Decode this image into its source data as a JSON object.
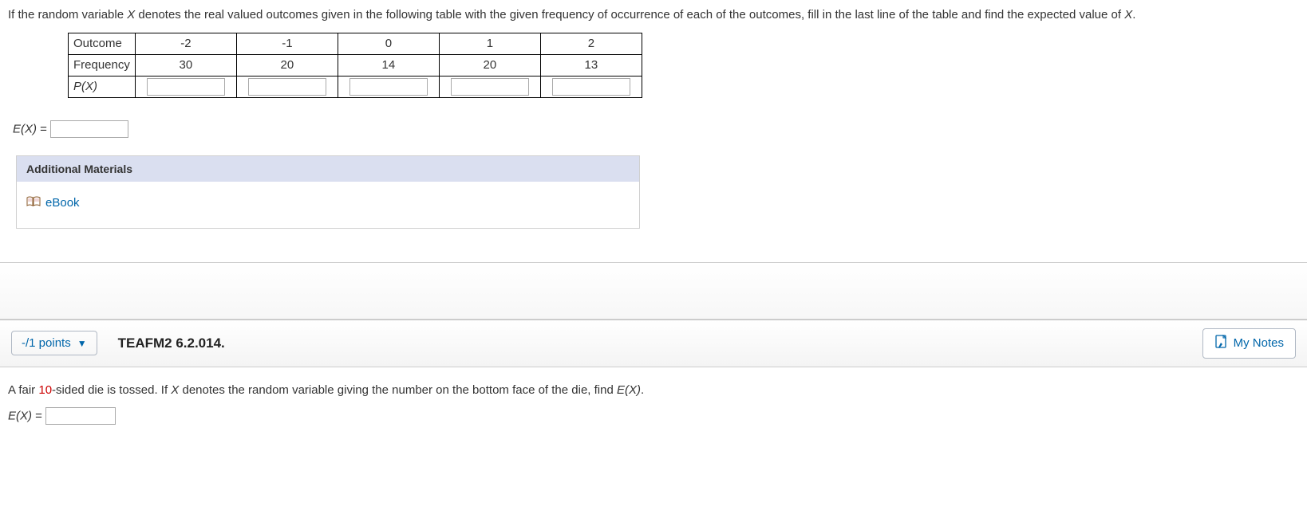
{
  "q1": {
    "prompt_pre": "If the random variable ",
    "var1": "X",
    "prompt_mid": " denotes the real valued outcomes given in the following table with the given frequency of occurrence of each of the outcomes, fill in the last line of the table and find the expected value of ",
    "var2": "X",
    "prompt_post": ".",
    "table": {
      "row_outcome_label": "Outcome",
      "row_freq_label": "Frequency",
      "row_px_label": "P(X)",
      "outcomes": [
        "-2",
        "-1",
        "0",
        "1",
        "2"
      ],
      "frequencies": [
        "30",
        "20",
        "14",
        "20",
        "13"
      ]
    },
    "ex_label_pre": "E(X) ",
    "ex_label_eq": "= ",
    "materials_header": "Additional Materials",
    "ebook_label": "eBook"
  },
  "header2": {
    "points_text": "-/1 points",
    "code": "TEAFM2 6.2.014.",
    "mynotes": "My Notes"
  },
  "q2": {
    "prompt_a": "A fair ",
    "sides": "10",
    "prompt_b": "-sided die is tossed. If ",
    "var1": "X",
    "prompt_c": " denotes the random variable giving the number on the bottom face of the die, find ",
    "ex_inline_pre": "E(X)",
    "prompt_d": ".",
    "ex_label_pre": "E(X) ",
    "ex_label_eq": "= "
  }
}
